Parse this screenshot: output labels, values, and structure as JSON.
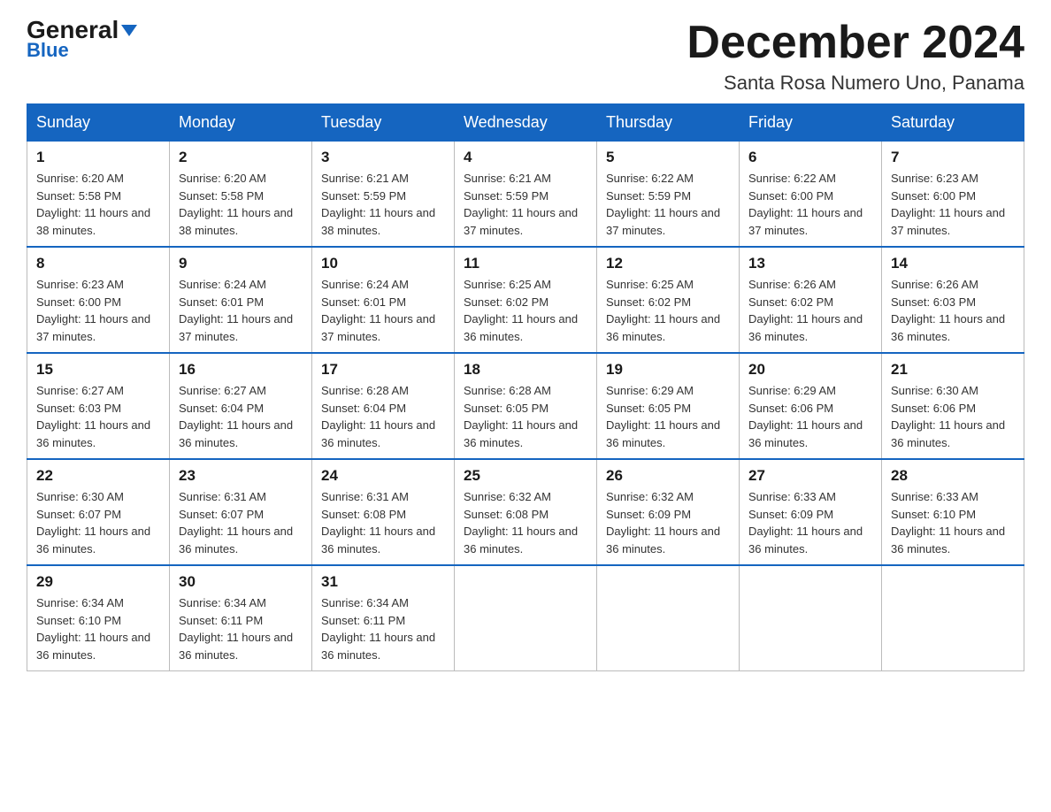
{
  "header": {
    "logo_general": "General",
    "logo_arrow": "▼",
    "logo_blue": "Blue",
    "month_title": "December 2024",
    "location": "Santa Rosa Numero Uno, Panama"
  },
  "days_of_week": [
    "Sunday",
    "Monday",
    "Tuesday",
    "Wednesday",
    "Thursday",
    "Friday",
    "Saturday"
  ],
  "weeks": [
    [
      {
        "day": "1",
        "sunrise": "6:20 AM",
        "sunset": "5:58 PM",
        "daylight": "11 hours and 38 minutes."
      },
      {
        "day": "2",
        "sunrise": "6:20 AM",
        "sunset": "5:58 PM",
        "daylight": "11 hours and 38 minutes."
      },
      {
        "day": "3",
        "sunrise": "6:21 AM",
        "sunset": "5:59 PM",
        "daylight": "11 hours and 38 minutes."
      },
      {
        "day": "4",
        "sunrise": "6:21 AM",
        "sunset": "5:59 PM",
        "daylight": "11 hours and 37 minutes."
      },
      {
        "day": "5",
        "sunrise": "6:22 AM",
        "sunset": "5:59 PM",
        "daylight": "11 hours and 37 minutes."
      },
      {
        "day": "6",
        "sunrise": "6:22 AM",
        "sunset": "6:00 PM",
        "daylight": "11 hours and 37 minutes."
      },
      {
        "day": "7",
        "sunrise": "6:23 AM",
        "sunset": "6:00 PM",
        "daylight": "11 hours and 37 minutes."
      }
    ],
    [
      {
        "day": "8",
        "sunrise": "6:23 AM",
        "sunset": "6:00 PM",
        "daylight": "11 hours and 37 minutes."
      },
      {
        "day": "9",
        "sunrise": "6:24 AM",
        "sunset": "6:01 PM",
        "daylight": "11 hours and 37 minutes."
      },
      {
        "day": "10",
        "sunrise": "6:24 AM",
        "sunset": "6:01 PM",
        "daylight": "11 hours and 37 minutes."
      },
      {
        "day": "11",
        "sunrise": "6:25 AM",
        "sunset": "6:02 PM",
        "daylight": "11 hours and 36 minutes."
      },
      {
        "day": "12",
        "sunrise": "6:25 AM",
        "sunset": "6:02 PM",
        "daylight": "11 hours and 36 minutes."
      },
      {
        "day": "13",
        "sunrise": "6:26 AM",
        "sunset": "6:02 PM",
        "daylight": "11 hours and 36 minutes."
      },
      {
        "day": "14",
        "sunrise": "6:26 AM",
        "sunset": "6:03 PM",
        "daylight": "11 hours and 36 minutes."
      }
    ],
    [
      {
        "day": "15",
        "sunrise": "6:27 AM",
        "sunset": "6:03 PM",
        "daylight": "11 hours and 36 minutes."
      },
      {
        "day": "16",
        "sunrise": "6:27 AM",
        "sunset": "6:04 PM",
        "daylight": "11 hours and 36 minutes."
      },
      {
        "day": "17",
        "sunrise": "6:28 AM",
        "sunset": "6:04 PM",
        "daylight": "11 hours and 36 minutes."
      },
      {
        "day": "18",
        "sunrise": "6:28 AM",
        "sunset": "6:05 PM",
        "daylight": "11 hours and 36 minutes."
      },
      {
        "day": "19",
        "sunrise": "6:29 AM",
        "sunset": "6:05 PM",
        "daylight": "11 hours and 36 minutes."
      },
      {
        "day": "20",
        "sunrise": "6:29 AM",
        "sunset": "6:06 PM",
        "daylight": "11 hours and 36 minutes."
      },
      {
        "day": "21",
        "sunrise": "6:30 AM",
        "sunset": "6:06 PM",
        "daylight": "11 hours and 36 minutes."
      }
    ],
    [
      {
        "day": "22",
        "sunrise": "6:30 AM",
        "sunset": "6:07 PM",
        "daylight": "11 hours and 36 minutes."
      },
      {
        "day": "23",
        "sunrise": "6:31 AM",
        "sunset": "6:07 PM",
        "daylight": "11 hours and 36 minutes."
      },
      {
        "day": "24",
        "sunrise": "6:31 AM",
        "sunset": "6:08 PM",
        "daylight": "11 hours and 36 minutes."
      },
      {
        "day": "25",
        "sunrise": "6:32 AM",
        "sunset": "6:08 PM",
        "daylight": "11 hours and 36 minutes."
      },
      {
        "day": "26",
        "sunrise": "6:32 AM",
        "sunset": "6:09 PM",
        "daylight": "11 hours and 36 minutes."
      },
      {
        "day": "27",
        "sunrise": "6:33 AM",
        "sunset": "6:09 PM",
        "daylight": "11 hours and 36 minutes."
      },
      {
        "day": "28",
        "sunrise": "6:33 AM",
        "sunset": "6:10 PM",
        "daylight": "11 hours and 36 minutes."
      }
    ],
    [
      {
        "day": "29",
        "sunrise": "6:34 AM",
        "sunset": "6:10 PM",
        "daylight": "11 hours and 36 minutes."
      },
      {
        "day": "30",
        "sunrise": "6:34 AM",
        "sunset": "6:11 PM",
        "daylight": "11 hours and 36 minutes."
      },
      {
        "day": "31",
        "sunrise": "6:34 AM",
        "sunset": "6:11 PM",
        "daylight": "11 hours and 36 minutes."
      },
      null,
      null,
      null,
      null
    ]
  ]
}
